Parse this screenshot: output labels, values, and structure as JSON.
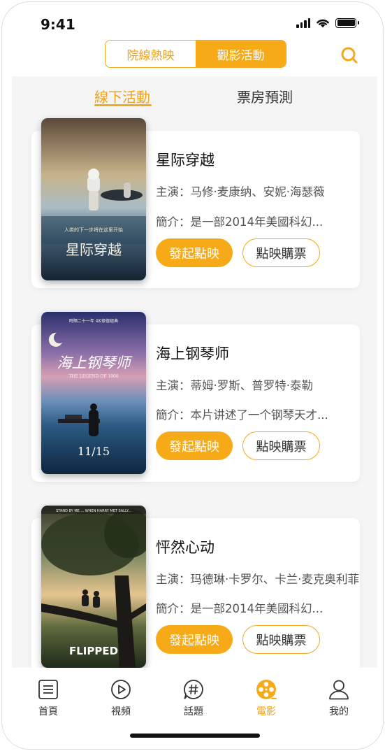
{
  "status_bar": {
    "time": "9:41"
  },
  "top_tabs": [
    {
      "label": "院線熱映",
      "active": false
    },
    {
      "label": "觀影活動",
      "active": true
    }
  ],
  "sub_tabs": [
    {
      "label": "線下活動",
      "active": true
    },
    {
      "label": "票房預測",
      "active": false
    }
  ],
  "movies": [
    {
      "title": "星际穿越",
      "cast": "主演：马修·麦康纳、安妮·海瑟薇",
      "desc": "簡介：是一部2014年美國科幻...",
      "primary_button": "發起點映",
      "secondary_button": "點映購票",
      "poster_title": "星际穿越",
      "poster_tagline": "人类的下一步将在这里开始"
    },
    {
      "title": "海上钢琴师",
      "cast": "主演：蒂姆·罗斯、普罗特·泰勒",
      "desc": "簡介：本片讲述了一个钢琴天才...",
      "primary_button": "發起點映",
      "secondary_button": "點映購票",
      "poster_title": "海上钢琴师",
      "poster_subtitle": "THE LEGEND OF 1900",
      "poster_date": "11/15",
      "poster_tagline": "時隔二十一年 4K修復經典"
    },
    {
      "title": "怦然心动",
      "cast": "主演：玛德琳·卡罗尔、卡兰·麦克奥利菲",
      "desc": "簡介：是一部2014年美國科幻...",
      "primary_button": "發起點映",
      "secondary_button": "點映購票",
      "poster_title": "FLIPPED",
      "poster_tagline": "STAND BY ME ... WHEN HARRY MET SALLY..."
    }
  ],
  "bottom_nav": [
    {
      "label": "首頁",
      "icon": "home-icon",
      "active": false
    },
    {
      "label": "視頻",
      "icon": "video-play-icon",
      "active": false
    },
    {
      "label": "話題",
      "icon": "topic-hash-icon",
      "active": false
    },
    {
      "label": "電影",
      "icon": "film-reel-icon",
      "active": true
    },
    {
      "label": "我的",
      "icon": "profile-icon",
      "active": false
    }
  ],
  "colors": {
    "accent": "#f6aa18",
    "background": "#f5f5f5"
  }
}
